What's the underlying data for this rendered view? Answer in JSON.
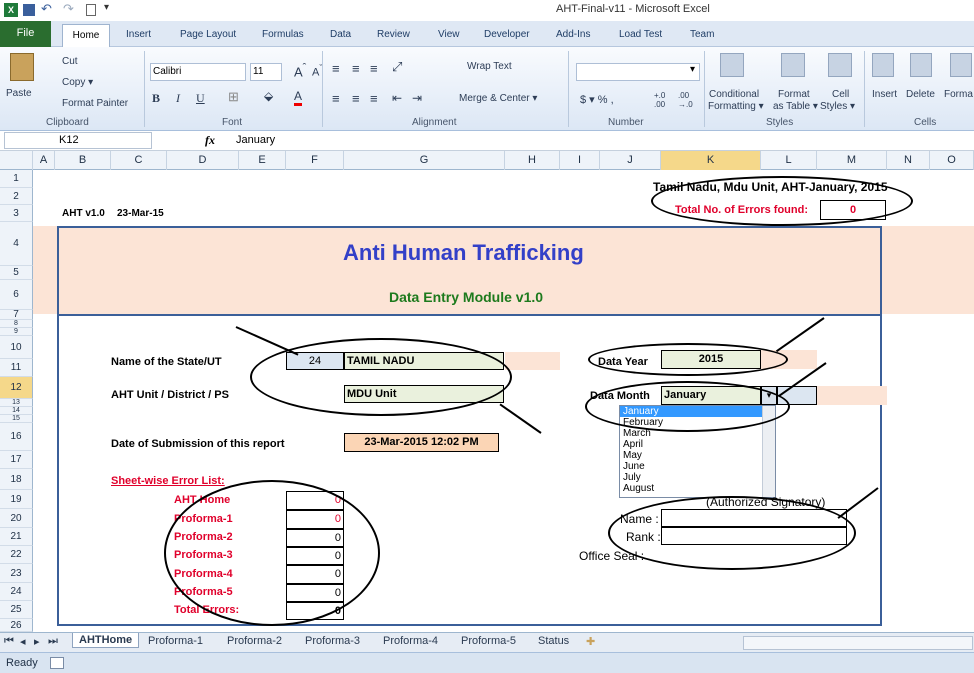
{
  "window": {
    "title": "AHT-Final-v11 - Microsoft Excel"
  },
  "tabs": {
    "file": "File",
    "home": "Home",
    "others": [
      "Insert",
      "Page Layout",
      "Formulas",
      "Data",
      "Review",
      "View",
      "Developer",
      "Add-Ins",
      "Load Test",
      "Team"
    ]
  },
  "ribbon": {
    "paste": "Paste",
    "cut": "Cut",
    "copy": "Copy ▾",
    "format_painter": "Format Painter",
    "clipboard_group": "Clipboard",
    "font_name": "Calibri",
    "font_size": "11",
    "font_group": "Font",
    "wrap_text": "Wrap Text",
    "merge_center": "Merge & Center ▾",
    "alignment_group": "Alignment",
    "number_format": "",
    "number_group": "Number",
    "number_symbols": "$ ▾ % ,",
    "conditional": "Conditional",
    "formatting": "Formatting ▾",
    "format_as": "Format",
    "as_table": "as Table ▾",
    "cell_styles": "Cell",
    "styles_label": "Styles ▾",
    "styles_group": "Styles",
    "insert": "Insert",
    "delete": "Delete",
    "format": "Forma",
    "cells_group": "Cells"
  },
  "formula_bar": {
    "name_box": "K12",
    "fx": "fx",
    "value": "January"
  },
  "columns": [
    "A",
    "B",
    "C",
    "D",
    "E",
    "F",
    "G",
    "H",
    "I",
    "J",
    "K",
    "L",
    "M",
    "N",
    "O"
  ],
  "rows": [
    "1",
    "2",
    "3",
    "4",
    "5",
    "6",
    "7",
    "8",
    "9",
    "10",
    "11",
    "12",
    "13",
    "14",
    "15",
    "16",
    "17",
    "18",
    "19",
    "20",
    "21",
    "22",
    "23",
    "24",
    "25",
    "26"
  ],
  "sheet": {
    "header_right": "Tamil Nadu, Mdu Unit, AHT-January, 2015",
    "version": "AHT v1.0",
    "version_date": "23-Mar-15",
    "total_errors_label": "Total No. of Errors found:",
    "total_errors_value": "0",
    "title": "Anti Human Trafficking",
    "subtitle": "Data Entry Module v1.0",
    "state_label": "Name of the State/UT",
    "state_code": "24",
    "state_name": "TAMIL NADU",
    "unit_label": "AHT Unit / District / PS",
    "unit_value": "MDU Unit",
    "date_label": "Date of Submission of this report",
    "date_value": "23-Mar-2015  12:02 PM",
    "data_year_label": "Data Year",
    "data_year_value": "2015",
    "data_month_label": "Data Month",
    "data_month_value": "January",
    "error_list_title": "Sheet-wise Error List:",
    "errors": [
      {
        "name": "AHT Home",
        "value": "0"
      },
      {
        "name": "Proforma-1",
        "value": "0"
      },
      {
        "name": "Proforma-2",
        "value": "0"
      },
      {
        "name": "Proforma-3",
        "value": "0"
      },
      {
        "name": "Proforma-4",
        "value": "0"
      },
      {
        "name": "Proforma-5",
        "value": "0"
      },
      {
        "name": "Total Errors:",
        "value": "0"
      }
    ],
    "signatory": "(Authorized Signatory)",
    "name_label": "Name :",
    "rank_label": "Rank :",
    "seal_label": "Office Seal :"
  },
  "dropdown_options": [
    "January",
    "February",
    "March",
    "April",
    "May",
    "June",
    "July",
    "August"
  ],
  "sheet_tabs": [
    "AHTHome",
    "Proforma-1",
    "Proforma-2",
    "Proforma-3",
    "Proforma-4",
    "Proforma-5",
    "Status"
  ],
  "status": {
    "ready": "Ready"
  }
}
